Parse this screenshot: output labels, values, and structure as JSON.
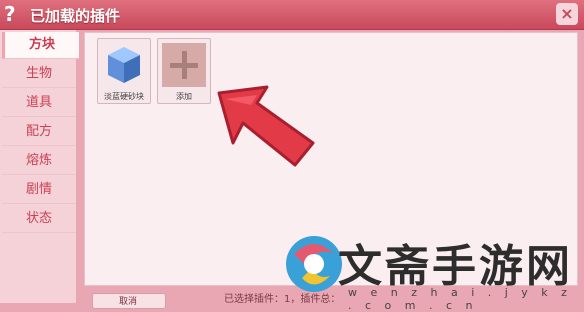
{
  "window": {
    "title_icon": "?",
    "title": "已加载的插件",
    "close_label": "×"
  },
  "sidebar": {
    "items": [
      {
        "label": "方块",
        "active": true
      },
      {
        "label": "生物"
      },
      {
        "label": "道具"
      },
      {
        "label": "配方"
      },
      {
        "label": "熔炼"
      },
      {
        "label": "剧情"
      },
      {
        "label": "状态"
      }
    ]
  },
  "plugins": [
    {
      "label": "淡蓝硬砂块",
      "icon": "blue-cube-icon"
    },
    {
      "label": "添加",
      "icon": "plus-icon"
    }
  ],
  "status": {
    "text": "已选择插件：1，插件总："
  },
  "bottom_button": {
    "label": "取消"
  },
  "watermark": {
    "text": "文斋手游网",
    "url": "w e n z h a i . j y k z . c o m . c n"
  },
  "colors": {
    "titlebar": "#d45a6b",
    "accent": "#cc4255",
    "arrow": "#e23b47"
  }
}
